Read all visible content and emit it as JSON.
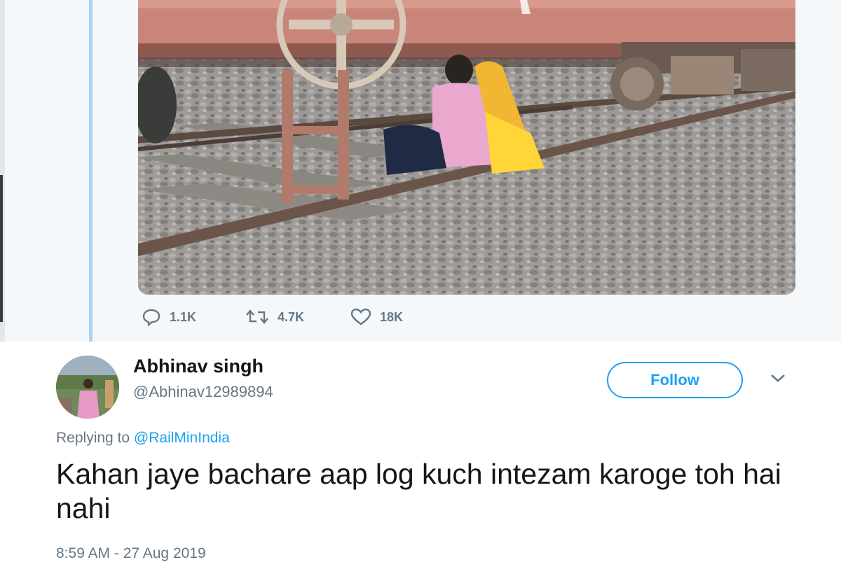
{
  "quoted_tweet": {
    "stats": {
      "replies": "1.1K",
      "retweets": "4.7K",
      "likes": "18K"
    }
  },
  "reply_tweet": {
    "author_name": "Abhinav singh",
    "author_handle": "@Abhinav12989894",
    "follow_label": "Follow",
    "replying_prefix": "Replying to",
    "replying_mention": "@RailMinIndia",
    "text": "Kahan jaye bachare aap log kuch intezam karoge toh hai nahi",
    "timestamp": "8:59 AM - 27 Aug 2019"
  },
  "colors": {
    "accent": "#1da1f2",
    "muted": "#657786",
    "thread_line": "#aad4f0",
    "quoted_bg": "#f5f8fa"
  },
  "icons": [
    "reply-icon",
    "retweet-icon",
    "like-icon",
    "chevron-down-icon"
  ]
}
